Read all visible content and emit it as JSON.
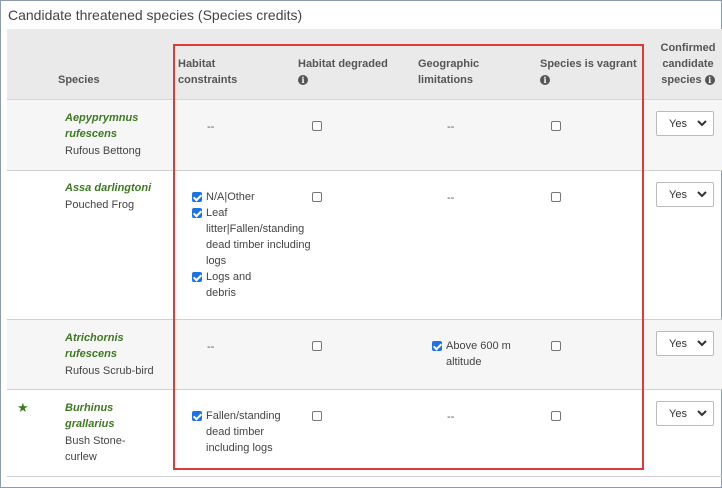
{
  "section_title": "Candidate threatened species (Species credits)",
  "columns": {
    "species": "Species",
    "habitat_constraints": [
      "Habitat",
      "constraints"
    ],
    "habitat_degraded": "Habitat degraded",
    "geographic_limitations": [
      "Geographic",
      "limitations"
    ],
    "species_vagrant": "Species is vagrant",
    "confirmed": [
      "Confirmed",
      "candidate",
      "species"
    ],
    "info_glyph": "i"
  },
  "rows": [
    {
      "scientific": [
        "Aepyprymnus",
        "rufescens"
      ],
      "common": [
        "Rufous Bettong"
      ],
      "starred": false,
      "habitat_constraints_dash": "--",
      "habitat_degraded": false,
      "geographic_dash": "--",
      "vagrant": false,
      "confirmed": "Yes"
    },
    {
      "scientific": [
        "Assa darlingtoni"
      ],
      "common": [
        "Pouched Frog"
      ],
      "starred": false,
      "habitat_constraints": [
        {
          "checked": true,
          "label": "N/A|Other"
        },
        {
          "checked": true,
          "label": "Leaf litter|Fallen/standing dead timber including logs"
        },
        {
          "checked": true,
          "label": "Logs and debris"
        }
      ],
      "habitat_degraded": false,
      "geographic_dash": "--",
      "vagrant": false,
      "confirmed": "Yes"
    },
    {
      "scientific": [
        "Atrichornis",
        "rufescens"
      ],
      "common": [
        "Rufous Scrub-bird"
      ],
      "starred": false,
      "habitat_constraints_dash": "--",
      "habitat_degraded": false,
      "geographic": {
        "checked": true,
        "label": "Above 600 m altitude"
      },
      "vagrant": false,
      "confirmed": "Yes"
    },
    {
      "scientific": [
        "Burhinus",
        "grallarius"
      ],
      "common": [
        "Bush Stone-",
        "curlew"
      ],
      "starred": true,
      "star_glyph": "★",
      "habitat_constraints": [
        {
          "checked": true,
          "label": "Fallen/standing dead timber including logs"
        }
      ],
      "habitat_degraded": false,
      "geographic_dash": "--",
      "vagrant": false,
      "confirmed": "Yes"
    }
  ],
  "colors": {
    "species_green": "#3e7a22",
    "highlight_red": "#e03b3b",
    "header_bg": "#eaeaea",
    "checkbox_blue": "#1a73e8"
  }
}
